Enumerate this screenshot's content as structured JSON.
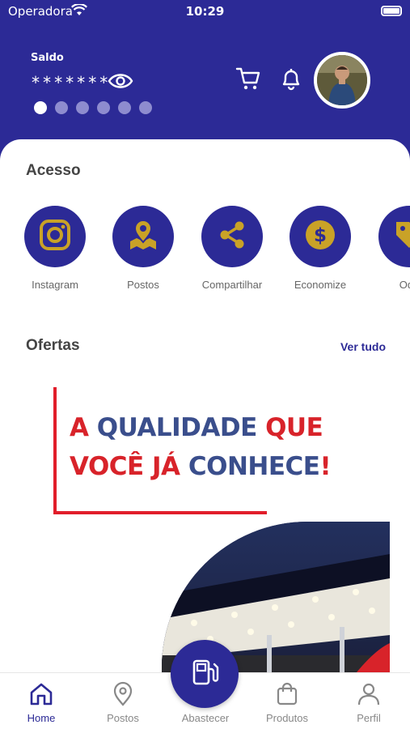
{
  "status_bar": {
    "carrier": "Operadora",
    "time": "10:29"
  },
  "header": {
    "saldo_label": "Saldo",
    "saldo_value": "*******",
    "pager": {
      "count": 6,
      "active": 1
    }
  },
  "acesso": {
    "title": "Acesso",
    "items": [
      {
        "label": "Instagram",
        "icon": "instagram-icon"
      },
      {
        "label": "Postos",
        "icon": "map-pin-icon"
      },
      {
        "label": "Compartilhar",
        "icon": "share-icon"
      },
      {
        "label": "Economize",
        "icon": "dollar-icon"
      },
      {
        "label": "Ode",
        "icon": "tag-icon"
      }
    ]
  },
  "ofertas": {
    "title": "Ofertas",
    "ver_tudo": "Ver tudo",
    "banner": {
      "line1_red": "A ",
      "line1_blue": "QUALIDADE ",
      "line1_red2": "QUE",
      "line2_red": "VOCÊ JÁ ",
      "line2_blue": "CONHECE",
      "line2_red2": "!"
    }
  },
  "tabbar": {
    "items": [
      {
        "label": "Home",
        "icon": "home-icon",
        "active": true
      },
      {
        "label": "Postos",
        "icon": "location-icon"
      },
      {
        "label": "Abastecer",
        "icon": "fuel-pump-icon"
      },
      {
        "label": "Produtos",
        "icon": "shopping-bag-icon"
      },
      {
        "label": "Perfil",
        "icon": "user-icon"
      }
    ]
  },
  "colors": {
    "primary": "#2c2a96",
    "accent_gold": "#c9a227",
    "banner_red": "#d8232a",
    "banner_blue": "#3a4e8c"
  }
}
